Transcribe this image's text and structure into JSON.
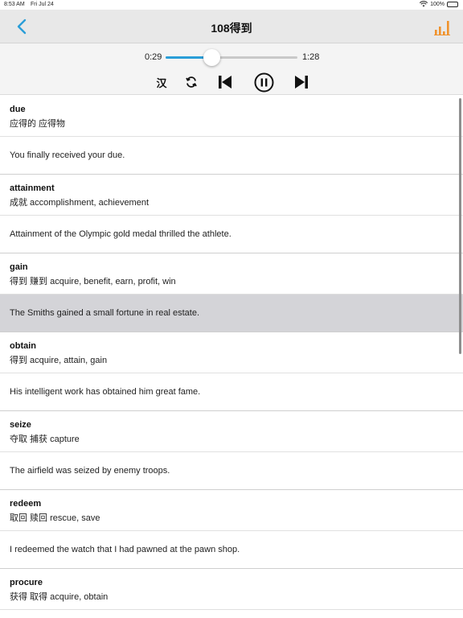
{
  "status_bar": {
    "time": "8:53 AM",
    "date": "Fri Jul 24",
    "battery": "100%"
  },
  "nav": {
    "title": "108得到"
  },
  "player": {
    "elapsed": "0:29",
    "total": "1:28",
    "progress": 0.35,
    "lang_label": "汉"
  },
  "colors": {
    "accent": "#2a9ed8",
    "stats_icon": "#f0922b",
    "selected_row": "#d4d4d8"
  },
  "entries": [
    {
      "word": "due",
      "meaning": "应得的 应得物",
      "example": "You finally received your due."
    },
    {
      "word": "attainment",
      "meaning": "成就 accomplishment, achievement",
      "example": "Attainment of the Olympic gold medal  thrilled the athlete."
    },
    {
      "word": "gain",
      "meaning": "得到 赚到 acquire, benefit, earn,  profit, win",
      "example": "The Smiths gained a small fortune in real  estate.",
      "selected": true
    },
    {
      "word": "obtain",
      "meaning": "得到 acquire, attain, gain",
      "example": "His intelligent work has obtained him great  fame."
    },
    {
      "word": "seize",
      "meaning": "夺取 捕获 capture",
      "example": "The airfield was seized by enemy troops."
    },
    {
      "word": "redeem",
      "meaning": "取回 赎回 rescue, save",
      "example": "I redeemed the watch that I had pawned at  the pawn shop."
    },
    {
      "word": "procure",
      "meaning": "获得 取得 acquire, obtain",
      "example": ""
    }
  ]
}
